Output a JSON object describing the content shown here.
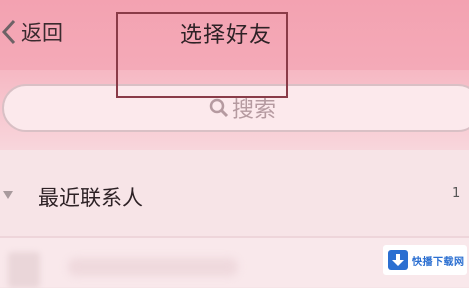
{
  "header": {
    "back_label": "返回",
    "title": "选择好友"
  },
  "search": {
    "label": "搜索"
  },
  "groups": [
    {
      "name": "最近联系人",
      "count": "1"
    }
  ],
  "watermark": {
    "text": "快播下载网"
  },
  "colors": {
    "header_bg": "#f3a2b1",
    "page_bg": "#f6e4e7",
    "watermark_blue": "#2b6fd1"
  }
}
